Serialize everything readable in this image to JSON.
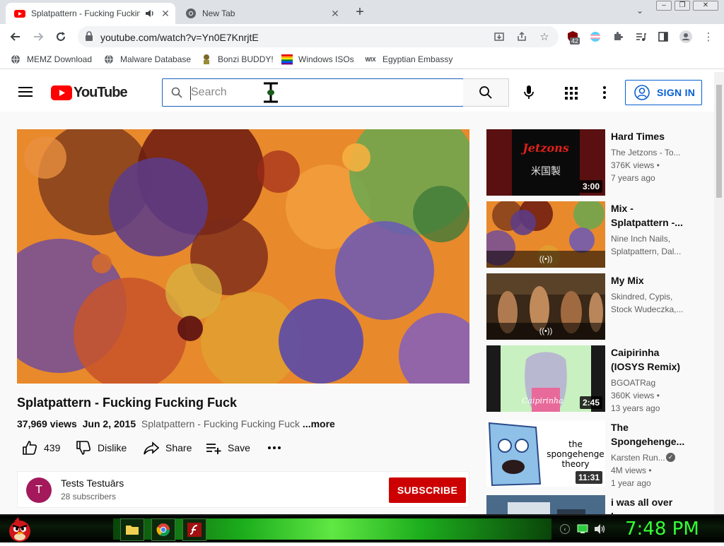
{
  "browser": {
    "tabs": [
      {
        "title": "Splatpattern - Fucking Fucking Fuck - YouTube",
        "active": true,
        "icon": "youtube-icon"
      },
      {
        "title": "New Tab",
        "active": false,
        "icon": "chrome-icon"
      }
    ],
    "new_tab_symbol": "+",
    "url": "youtube.com/watch?v=Yn0E7KnrjtE",
    "extension_badge": "42",
    "bookmarks": [
      {
        "label": "MEMZ Download",
        "icon": "globe-icon"
      },
      {
        "label": "Malware Database",
        "icon": "globe-icon"
      },
      {
        "label": "Bonzi BUDDY!",
        "icon": "bonzi-icon"
      },
      {
        "label": "Windows ISOs",
        "icon": "rainbow-icon"
      },
      {
        "label": "Egyptian Embassy",
        "icon": "wix-icon"
      }
    ],
    "bookmark_wix": "WIX"
  },
  "youtube": {
    "logo_text": "YouTube",
    "search_placeholder": "Search",
    "sign_in_label": "SIGN IN",
    "video": {
      "title": "Splatpattern - Fucking Fucking Fuck",
      "views": "37,969 views",
      "date": "Jun 2, 2015",
      "desc_snippet": "Splatpattern - Fucking Fucking Fuck",
      "more_label": "...more",
      "likes": "439",
      "dislike_label": "Dislike",
      "share_label": "Share",
      "save_label": "Save"
    },
    "channel": {
      "avatar_letter": "T",
      "name": "Tests Testuārs",
      "subscribers": "28 subscribers",
      "subscribe_label": "SUBSCRIBE"
    },
    "recommendations": [
      {
        "title": "Hard Times",
        "line1": "The Jetzons - To...",
        "line2": "376K views •",
        "line3": "7 years ago",
        "duration": "3:00",
        "thumb_text": "Jetzons",
        "kind": "video"
      },
      {
        "title": "Mix - Splatpattern -...",
        "line1": "Nine Inch Nails,",
        "line2": "Splatpattern, Dal...",
        "line3": "",
        "duration": "",
        "kind": "mix"
      },
      {
        "title": "My Mix",
        "line1": "Skindred, Cypis,",
        "line2": "Stock Wudeczka,...",
        "line3": "",
        "duration": "",
        "kind": "mix"
      },
      {
        "title": "Caipirinha (IOSYS Remix)",
        "line1": "BGOATRag",
        "line2": "360K views •",
        "line3": "13 years ago",
        "duration": "2:45",
        "thumb_text": "Caipirinha",
        "kind": "video"
      },
      {
        "title": "The Spongehenge...",
        "line1": "Karsten Run...",
        "line2": "4M views •",
        "line3": "1 year ago",
        "duration": "11:31",
        "thumb_text": "the spongehenge theory",
        "kind": "video"
      },
      {
        "title": "i was all over her",
        "line1": "",
        "line2": "",
        "line3": "",
        "duration": "",
        "kind": "video"
      }
    ],
    "mix_symbol": "((•))"
  },
  "taskbar": {
    "clock": "7:48 PM"
  },
  "colors": {
    "youtube_red": "#ff0000",
    "link_blue": "#065fd4",
    "subscribe_red": "#cc0000",
    "clock_green": "#35ff35"
  }
}
